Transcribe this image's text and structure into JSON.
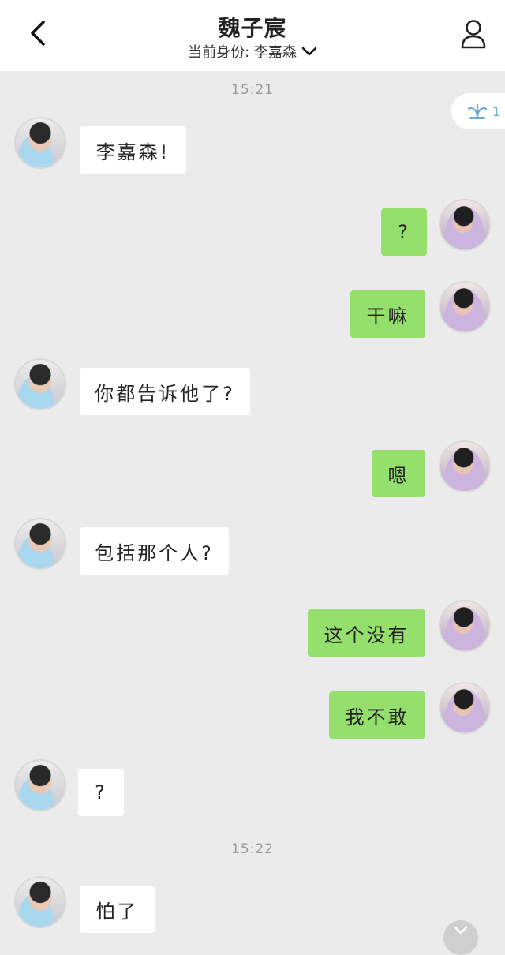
{
  "header": {
    "title": "魏子宸",
    "subtitle": "当前身份: 李嘉森",
    "back_icon": "chevron-left-icon",
    "profile_icon": "user-icon",
    "dropdown_icon": "chevron-down-icon"
  },
  "float_badge": {
    "icon": "fountain-icon",
    "text": "1"
  },
  "times": [
    "15:21",
    "15:22"
  ],
  "messages": [
    {
      "side": "left",
      "text": "李嘉森!"
    },
    {
      "side": "right",
      "text": "?"
    },
    {
      "side": "right",
      "text": "干嘛"
    },
    {
      "side": "left",
      "text": "你都告诉他了?"
    },
    {
      "side": "right",
      "text": "嗯"
    },
    {
      "side": "left",
      "text": "包括那个人?"
    },
    {
      "side": "right",
      "text": "这个没有"
    },
    {
      "side": "right",
      "text": "我不敢"
    },
    {
      "side": "left",
      "text": "?"
    },
    {
      "side": "left",
      "text": "怕了"
    }
  ],
  "colors": {
    "background": "#ebebeb",
    "incoming_bubble": "#ffffff",
    "outgoing_bubble": "#95e06c",
    "time_text": "#9a9a9a"
  }
}
